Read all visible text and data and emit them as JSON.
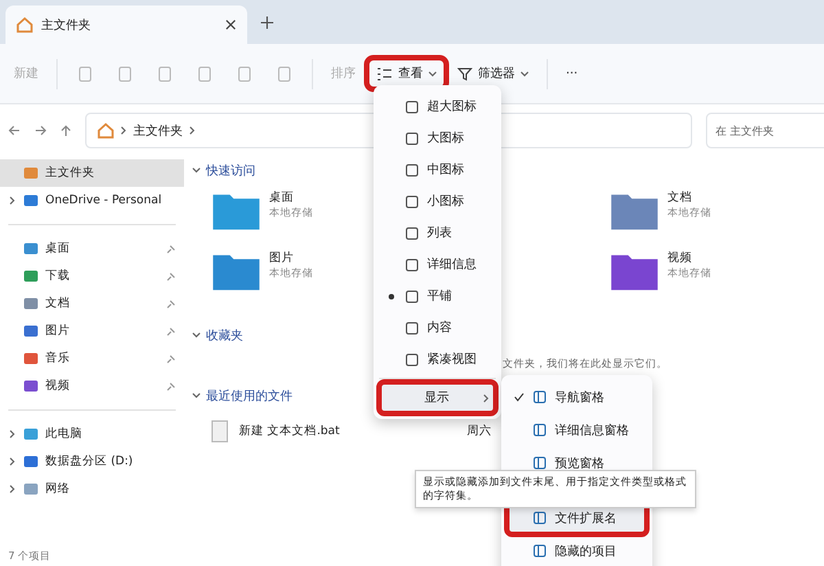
{
  "tabs": [
    {
      "label": "主文件夹",
      "selected": true
    }
  ],
  "toolbar": {
    "new_button": "新建",
    "sort_button": "排序",
    "view_button": {
      "label": "查看",
      "highlighted": true
    },
    "filter_button": "筛选器",
    "more_button": "···"
  },
  "address": {
    "path": "主文件夹",
    "search_placeholder": "在 主文件夹"
  },
  "sidebar": {
    "items": [
      {
        "label": "主文件夹",
        "selected": true,
        "pinned": false,
        "expandable": false
      },
      {
        "label": "OneDrive - Personal",
        "selected": false,
        "pinned": false,
        "expandable": true
      },
      {
        "label": "桌面",
        "selected": false,
        "pinned": true,
        "expandable": false
      },
      {
        "label": "下载",
        "selected": false,
        "pinned": true,
        "expandable": false
      },
      {
        "label": "文档",
        "selected": false,
        "pinned": true,
        "expandable": false
      },
      {
        "label": "图片",
        "selected": false,
        "pinned": true,
        "expandable": false
      },
      {
        "label": "音乐",
        "selected": false,
        "pinned": true,
        "expandable": false
      },
      {
        "label": "视频",
        "selected": false,
        "pinned": true,
        "expandable": false
      },
      {
        "label": "此电脑",
        "selected": false,
        "pinned": false,
        "expandable": true
      },
      {
        "label": "数据盘分区 (D:)",
        "selected": false,
        "pinned": false,
        "expandable": true
      },
      {
        "label": "网络",
        "selected": false,
        "pinned": false,
        "expandable": true
      }
    ]
  },
  "content": {
    "quick_access": {
      "title": "快速访问",
      "folders": [
        {
          "name": "桌面",
          "subtitle": "本地存储"
        },
        {
          "name": "文档",
          "subtitle": "本地存储"
        },
        {
          "name": "图片",
          "subtitle": "本地存储"
        },
        {
          "name": "视频",
          "subtitle": "本地存储"
        }
      ]
    },
    "favorites": {
      "title": "收藏夹",
      "message": "文件夹，我们将在此处显示它们。"
    },
    "recent": {
      "title": "最近使用的文件",
      "files": [
        {
          "name": "新建 文本文档.bat",
          "date": "周六"
        }
      ]
    }
  },
  "status_bar": "7 个项目",
  "view_menu": {
    "items": [
      {
        "label": "超大图标",
        "selected": false
      },
      {
        "label": "大图标",
        "selected": false
      },
      {
        "label": "中图标",
        "selected": false
      },
      {
        "label": "小图标",
        "selected": false
      },
      {
        "label": "列表",
        "selected": false
      },
      {
        "label": "详细信息",
        "selected": false
      },
      {
        "label": "平铺",
        "selected": true
      },
      {
        "label": "内容",
        "selected": false
      },
      {
        "label": "紧凑视图",
        "selected": false
      }
    ],
    "show_item": {
      "label": "显示",
      "highlighted": true
    }
  },
  "show_submenu": {
    "items": [
      {
        "label": "导航窗格",
        "checked": true,
        "highlighted": false
      },
      {
        "label": "详细信息窗格",
        "checked": false,
        "highlighted": false
      },
      {
        "label": "预览窗格",
        "checked": false,
        "highlighted": false
      },
      {
        "label": "文件扩展名",
        "checked": false,
        "highlighted": true
      },
      {
        "label": "隐藏的项目",
        "checked": false,
        "highlighted": false
      }
    ]
  },
  "tooltip": "显示或隐藏添加到文件末尾、用于指定文件类型或格式的字符集。"
}
